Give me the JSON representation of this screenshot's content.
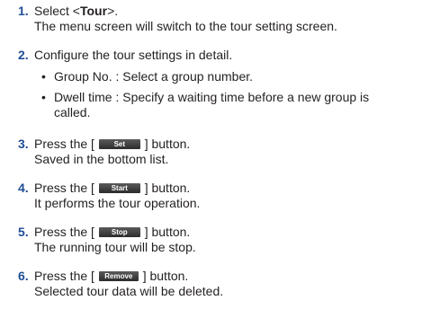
{
  "steps": [
    {
      "num": "1.",
      "pre": "Select <",
      "bold": "Tour",
      "post": ">.",
      "desc": "The menu screen will switch to the tour setting screen."
    },
    {
      "num": "2.",
      "text": "Configure the tour settings in detail.",
      "bullets": [
        {
          "dot": "•",
          "text": "Group No. : Select a group number."
        },
        {
          "dot": "•",
          "text": "Dwell time : Specify a waiting time before a new group is",
          "cont": "called."
        }
      ]
    },
    {
      "num": "3.",
      "pre": "Press the [",
      "button": "Set",
      "post": "] button.",
      "desc": "Saved in the bottom list."
    },
    {
      "num": "4.",
      "pre": "Press the [",
      "button": "Start",
      "post": "] button.",
      "desc": "It performs the tour operation."
    },
    {
      "num": "5.",
      "pre": "Press the [",
      "button": "Stop",
      "post": "] button.",
      "desc": "The running tour will be stop."
    },
    {
      "num": "6.",
      "pre": "Press the [",
      "button": "Remove",
      "post": "] button.",
      "desc": "Selected tour data will be deleted."
    }
  ]
}
